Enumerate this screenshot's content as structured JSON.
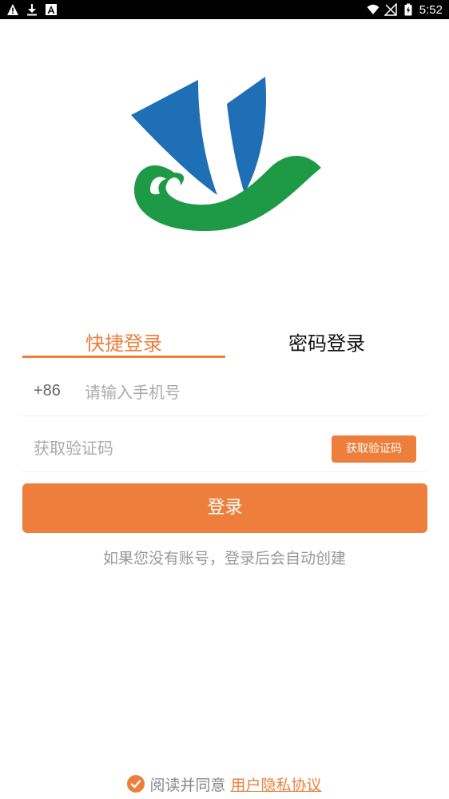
{
  "status_bar": {
    "time": "5:52",
    "left_icons": [
      "warning-icon",
      "download-icon",
      "font-icon"
    ],
    "right_icons": [
      "wifi-icon",
      "no-signal-icon",
      "battery-icon"
    ],
    "background": "#000000"
  },
  "logo": {
    "icon": "logo-icon",
    "colors": {
      "blue": "#1f6fb7",
      "green": "#1e9a46"
    }
  },
  "tabs": [
    {
      "label": "快捷登录",
      "active": true
    },
    {
      "label": "密码登录",
      "active": false
    }
  ],
  "phone": {
    "prefix": "+86",
    "placeholder": "请输入手机号",
    "value": ""
  },
  "code": {
    "placeholder": "获取验证码",
    "value": "",
    "button_label": "获取验证码"
  },
  "login_button": {
    "label": "登录"
  },
  "hint": "如果您没有账号，登录后会自动创建",
  "agreement": {
    "text": "阅读并同意",
    "link": "用户隐私协议",
    "checked": true
  },
  "colors": {
    "accent": "#ee7e3b",
    "text": "#111111",
    "muted": "#999999"
  }
}
